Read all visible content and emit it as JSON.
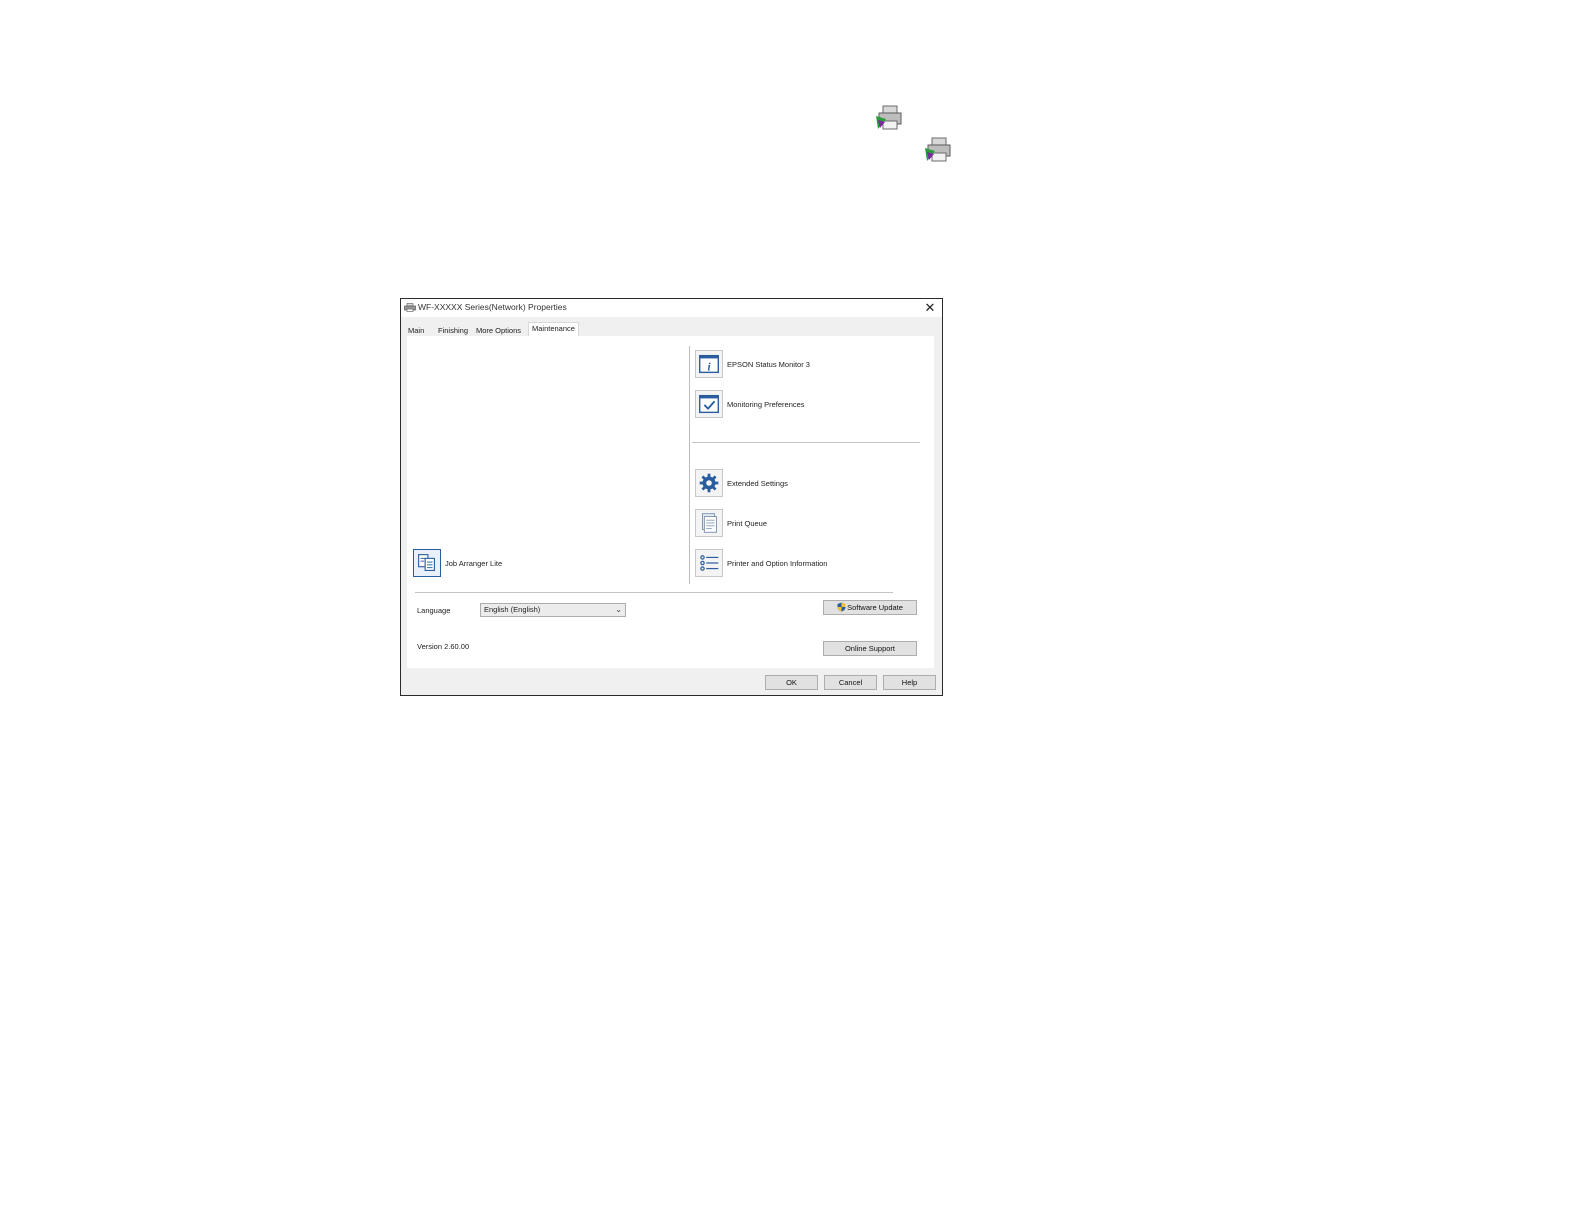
{
  "dialog": {
    "title": "WF-XXXXX Series(Network) Properties",
    "close_glyph": "✕"
  },
  "tabs": [
    {
      "label": "Main",
      "active": false
    },
    {
      "label": "Finishing",
      "active": false
    },
    {
      "label": "More Options",
      "active": false
    },
    {
      "label": "Maintenance",
      "active": true
    }
  ],
  "utilities": {
    "status_monitor": {
      "label": "EPSON Status Monitor 3",
      "icon": "info-icon"
    },
    "monitoring_preferences": {
      "label": "Monitoring Preferences",
      "icon": "checkmark-icon"
    },
    "extended_settings": {
      "label": "Extended Settings",
      "icon": "gear-icon"
    },
    "print_queue": {
      "label": "Print Queue",
      "icon": "document-icon"
    },
    "printer_info": {
      "label": "Printer and Option Information",
      "icon": "list-icon"
    },
    "job_arranger": {
      "label": "Job Arranger Lite",
      "icon": "job-arranger-icon"
    }
  },
  "language": {
    "label": "Language",
    "selected": "English (English)"
  },
  "version": "Version 2.60.00",
  "buttons": {
    "software_update": "Software Update",
    "online_support": "Online Support",
    "ok": "OK",
    "cancel": "Cancel",
    "help": "Help"
  },
  "colors": {
    "icon_blue": "#2a5d9f",
    "dialog_bg": "#f0f0f0",
    "panel_bg": "#ffffff"
  }
}
